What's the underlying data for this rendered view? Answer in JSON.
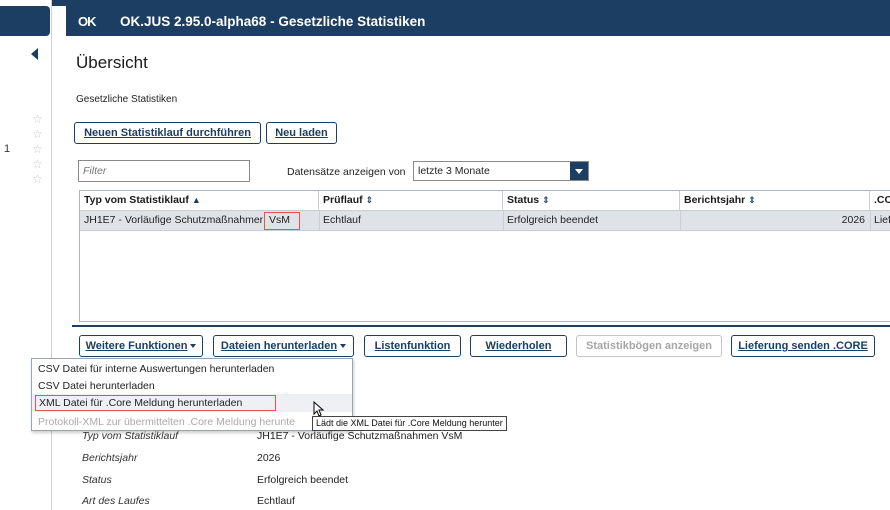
{
  "app": {
    "logo_text": "OK",
    "window_title": "OK.JUS 2.95.0-alpha68 - Gesetzliche Statistiken",
    "brand_color": "#1b3e62",
    "accent_color": "#e05555"
  },
  "sidebar": {
    "collapse_icon": "chevron-left-icon",
    "favorites": [
      {
        "number": "",
        "icon": "star-outline-icon"
      },
      {
        "number": "",
        "icon": "star-outline-icon"
      },
      {
        "number": "1",
        "icon": "star-outline-icon"
      },
      {
        "number": "",
        "icon": "star-outline-icon"
      },
      {
        "number": "",
        "icon": "star-outline-icon"
      }
    ]
  },
  "page": {
    "title": "Übersicht",
    "breadcrumb": "Gesetzliche Statistiken"
  },
  "toolbar": {
    "new_run_label": "Neuen Statistiklauf durchführen",
    "reload_label": "Neu laden"
  },
  "filter": {
    "placeholder": "Filter",
    "range_label": "Datensätze anzeigen von",
    "range_value": "letzte 3 Monate"
  },
  "table": {
    "columns": [
      {
        "label": "Typ vom Statistiklauf",
        "sort": "▲"
      },
      {
        "label": "Prüflauf",
        "sort": "⇕"
      },
      {
        "label": "Status",
        "sort": "⇕"
      },
      {
        "label": "Berichtsjahr",
        "sort": "⇕"
      },
      {
        "label": ".CO",
        "sort": ""
      }
    ],
    "rows": [
      {
        "type": "JH1E7 - Vorläufige Schutzmaßnahmen",
        "type_suffix": "VsM",
        "check_run": "Echtlauf",
        "status": "Erfolgreich beendet",
        "year": "2026",
        "core": "Lief"
      }
    ]
  },
  "actions": {
    "more_functions": "Weitere Funktionen",
    "download_files": "Dateien herunterladen",
    "list_function": "Listenfunktion",
    "repeat": "Wiederholen",
    "show_forms": "Statistikbögen anzeigen",
    "send_delivery": "Lieferung senden .CORE"
  },
  "download_menu": {
    "items": [
      {
        "label": "CSV Datei für interne Auswertungen herunterladen",
        "enabled": true
      },
      {
        "label": "CSV Datei herunterladen",
        "enabled": true
      },
      {
        "label": "XML Datei für .Core Meldung herunterladen",
        "enabled": true
      },
      {
        "label": "Protokoll-XML zur übermittelten .Core Meldung herunte",
        "enabled": false
      }
    ]
  },
  "tooltip": {
    "text": "Lädt die XML Datei für .Core Meldung herunter"
  },
  "detail": {
    "rows": [
      {
        "label": "Typ vom Statistiklauf",
        "value": "JH1E7 - Vorläufige Schutzmaßnahmen VsM"
      },
      {
        "label": "Berichtsjahr",
        "value": "2026"
      },
      {
        "label": "Status",
        "value": "Erfolgreich beendet"
      },
      {
        "label": "Art des Laufes",
        "value": "Echtlauf"
      }
    ]
  }
}
